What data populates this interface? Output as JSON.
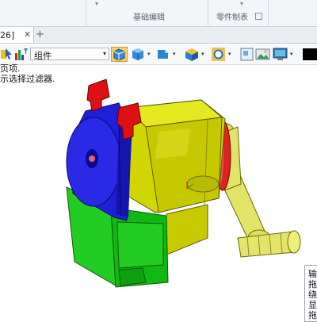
{
  "ribbon": {
    "group_basic_edit": "基础编辑",
    "group_part_drawing": "零件制表",
    "dropdown_mark": "▾"
  },
  "tabs": {
    "document_tab_label": "26]",
    "close_glyph": "✕",
    "add_glyph": "+"
  },
  "toolbar": {
    "filter_value": "组件",
    "filter_caret": "▾",
    "dropdown_glyph": "▾"
  },
  "messages": {
    "line1": "页项.",
    "line2": "示选择过滤器."
  },
  "context_menu": {
    "items": [
      "输",
      "拖",
      "绕",
      "显",
      "拖"
    ]
  },
  "model": {
    "colors": {
      "housing": "#d2d600",
      "front_cover": "#1f1fd8",
      "base": "#22cc22",
      "clips": "#dd1111",
      "gear": "#dd2222",
      "crank": "#e0e066"
    }
  }
}
